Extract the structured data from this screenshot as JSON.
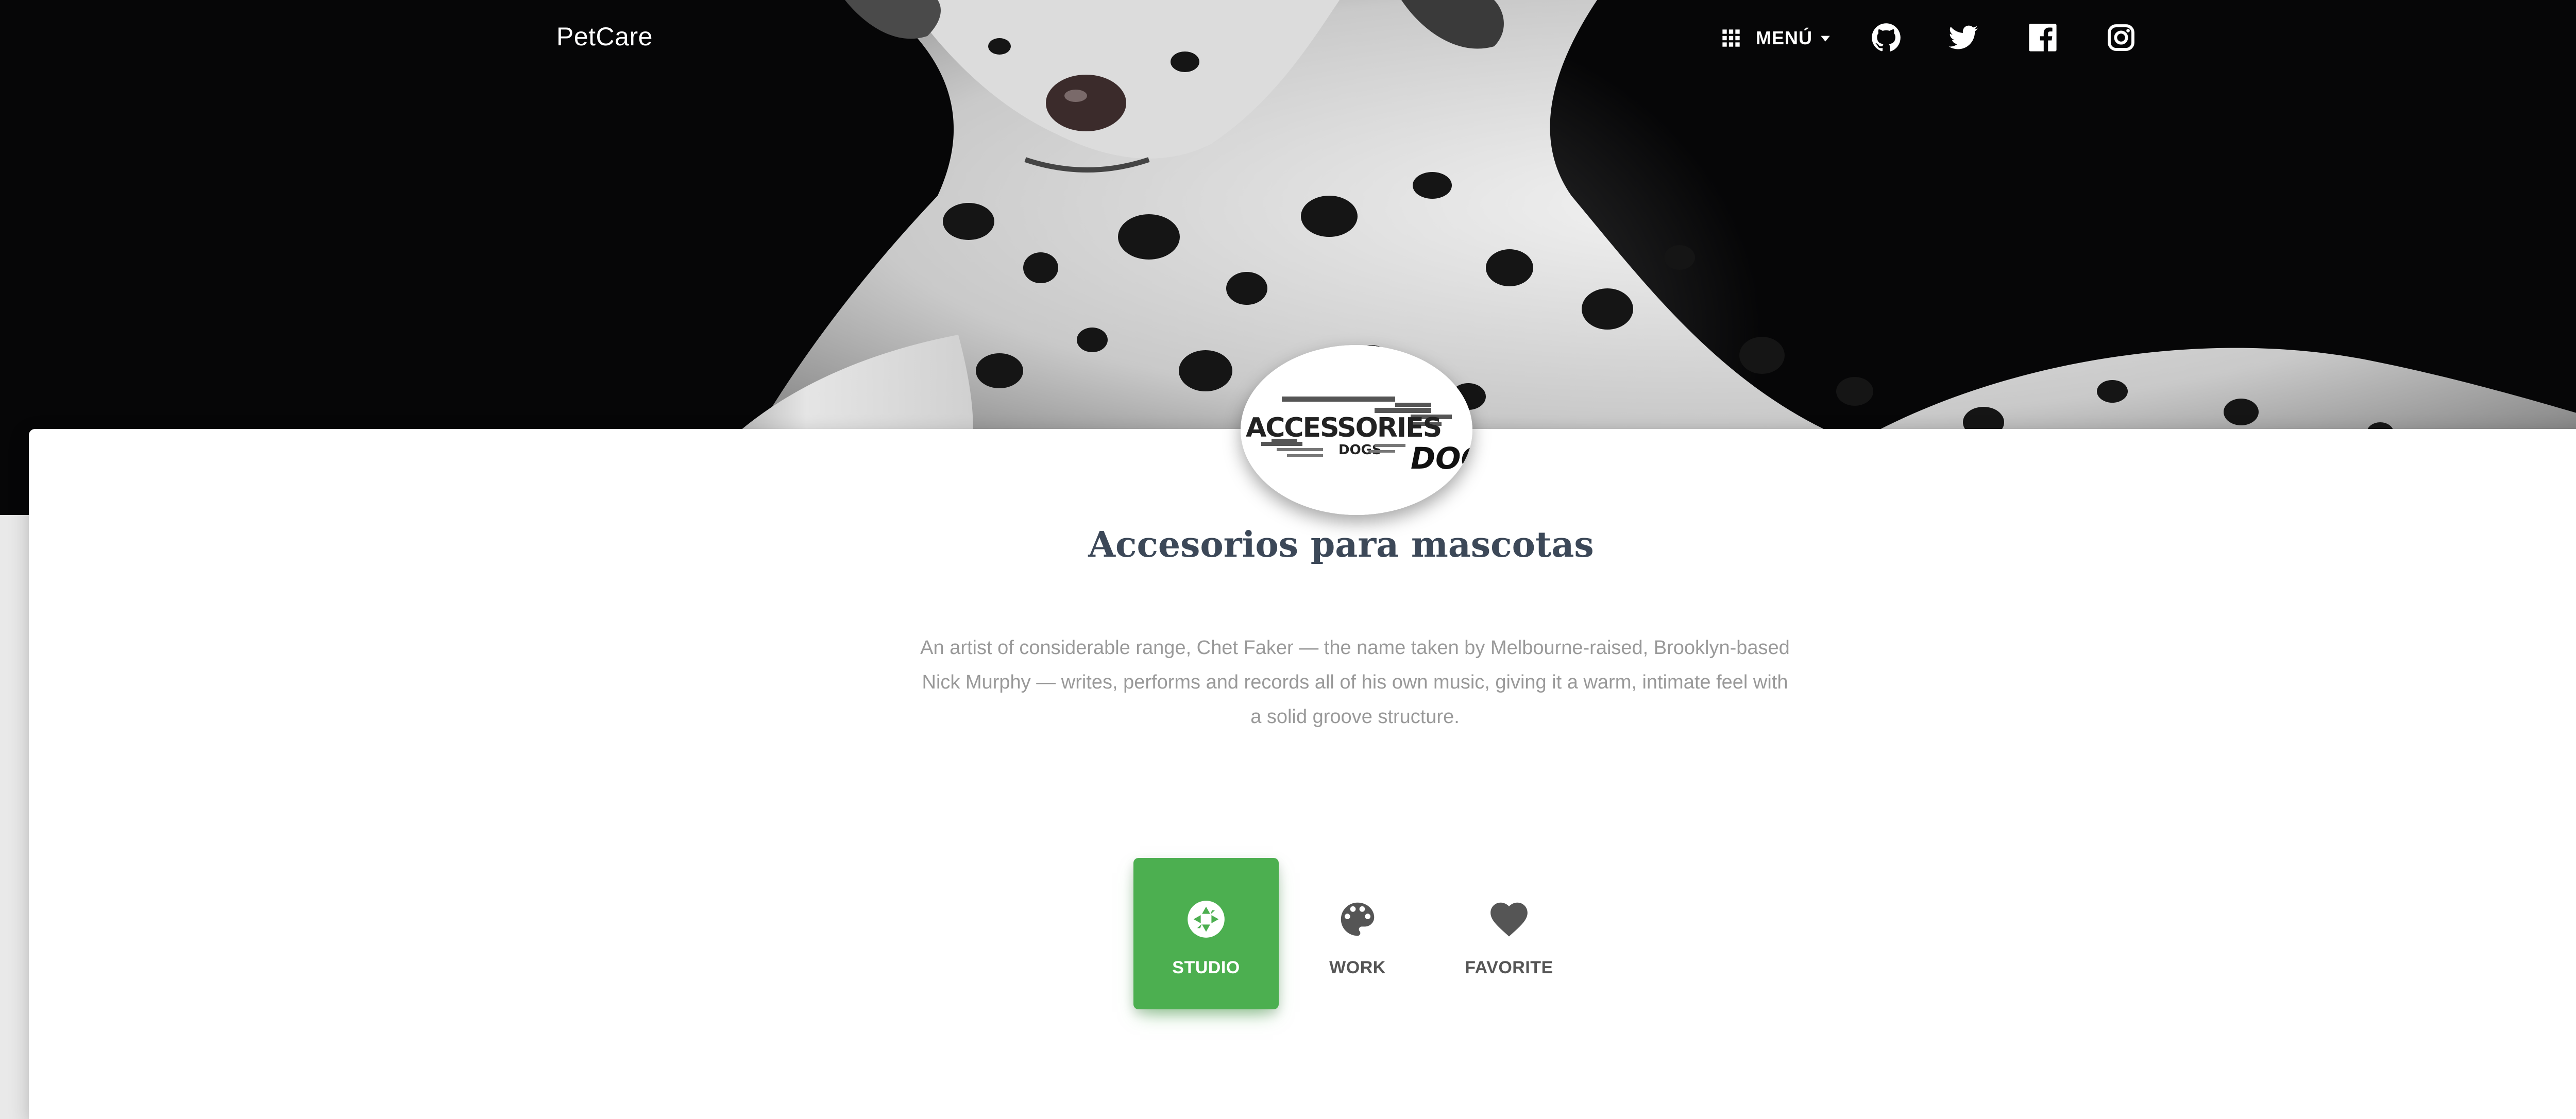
{
  "navbar": {
    "brand": "PetCare",
    "menu_label": "MENÚ",
    "menu_icon": "apps-grid-icon",
    "social": [
      {
        "name": "github-icon"
      },
      {
        "name": "twitter-icon"
      },
      {
        "name": "facebook-icon"
      },
      {
        "name": "instagram-icon"
      }
    ]
  },
  "hero": {
    "image": "dalmatian-dog-photo"
  },
  "profile": {
    "avatar_text": [
      "ACCESSORIES",
      "DOGS",
      "DOG"
    ],
    "title": "Accesorios para mascotas",
    "description": "An artist of considerable range, Chet Faker — the name taken by Melbourne-raised, Brooklyn-based Nick Murphy — writes, performs and records all of his own music, giving it a warm, intimate feel with a solid groove structure."
  },
  "tabs": [
    {
      "label": "STUDIO",
      "icon": "camera-aperture-icon",
      "active": true
    },
    {
      "label": "WORK",
      "icon": "palette-icon",
      "active": false
    },
    {
      "label": "FAVORITE",
      "icon": "heart-icon",
      "active": false
    }
  ],
  "colors": {
    "accent": "#4caf50",
    "title": "#3c4858",
    "description": "#999999",
    "hero_bg": "#060607"
  }
}
